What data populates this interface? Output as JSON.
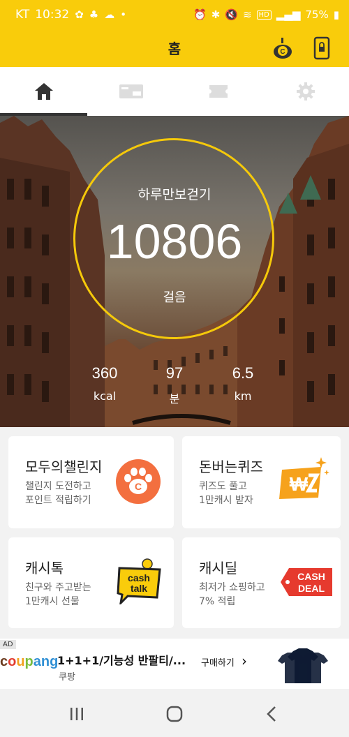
{
  "status_bar": {
    "carrier": "KT",
    "time": "10:32",
    "battery": "75%",
    "left_icons": [
      "notification-icon-1",
      "notification-icon-2",
      "notification-icon-3",
      "dot-icon"
    ],
    "right_icons": [
      "alarm-icon",
      "bluetooth-icon",
      "mute-icon",
      "wifi-icon",
      "hd-icon",
      "signal-icon",
      "battery-icon"
    ]
  },
  "app_bar": {
    "title": "홈",
    "right_icons": [
      "cashwalk-character-icon",
      "phone-lock-icon"
    ]
  },
  "tabs": [
    {
      "icon": "home-icon",
      "active": true
    },
    {
      "icon": "ticket-icon",
      "active": false
    },
    {
      "icon": "coupon-icon",
      "active": false
    },
    {
      "icon": "gear-icon",
      "active": false
    }
  ],
  "hero": {
    "label": "하루만보걷기",
    "steps": "10806",
    "unit": "걸음",
    "stats": [
      {
        "value": "360",
        "unit": "kcal"
      },
      {
        "value": "97",
        "unit": "분"
      },
      {
        "value": "6.5",
        "unit": "km"
      }
    ]
  },
  "cards": [
    {
      "title": "모두의챌린지",
      "desc": "챌린지 도전하고\n포인트 적립하기",
      "icon": "paw-coin-icon"
    },
    {
      "title": "돈버는퀴즈",
      "desc": "퀴즈도 풀고\n1만캐시 받자",
      "icon": "won-quiz-icon"
    },
    {
      "title": "캐시톡",
      "desc": "친구와 주고받는\n1만캐시 선물",
      "icon": "cash-talk-icon",
      "icon_text": [
        "cash",
        "talk"
      ]
    },
    {
      "title": "캐시딜",
      "desc": "최저가 쇼핑하고\n7% 적립",
      "icon": "cash-deal-icon",
      "icon_text": [
        "CASH",
        "DEAL"
      ]
    }
  ],
  "ad": {
    "tag": "AD",
    "brand": "coupang",
    "headline": "1+1+1/기능성 반팔티/...",
    "sub": "쿠팡",
    "cta": "구매하기",
    "chevron": "›",
    "image": "tshirt-product-image"
  },
  "nav_bar": [
    "recent-apps-icon",
    "home-circle-icon",
    "back-icon"
  ],
  "colors": {
    "brand_yellow": "#f9cc0b",
    "ring": "#f5c90a",
    "quiz_orange": "#f6a21c",
    "deal_red": "#e63a2e",
    "paw_orange": "#f36f3f"
  }
}
